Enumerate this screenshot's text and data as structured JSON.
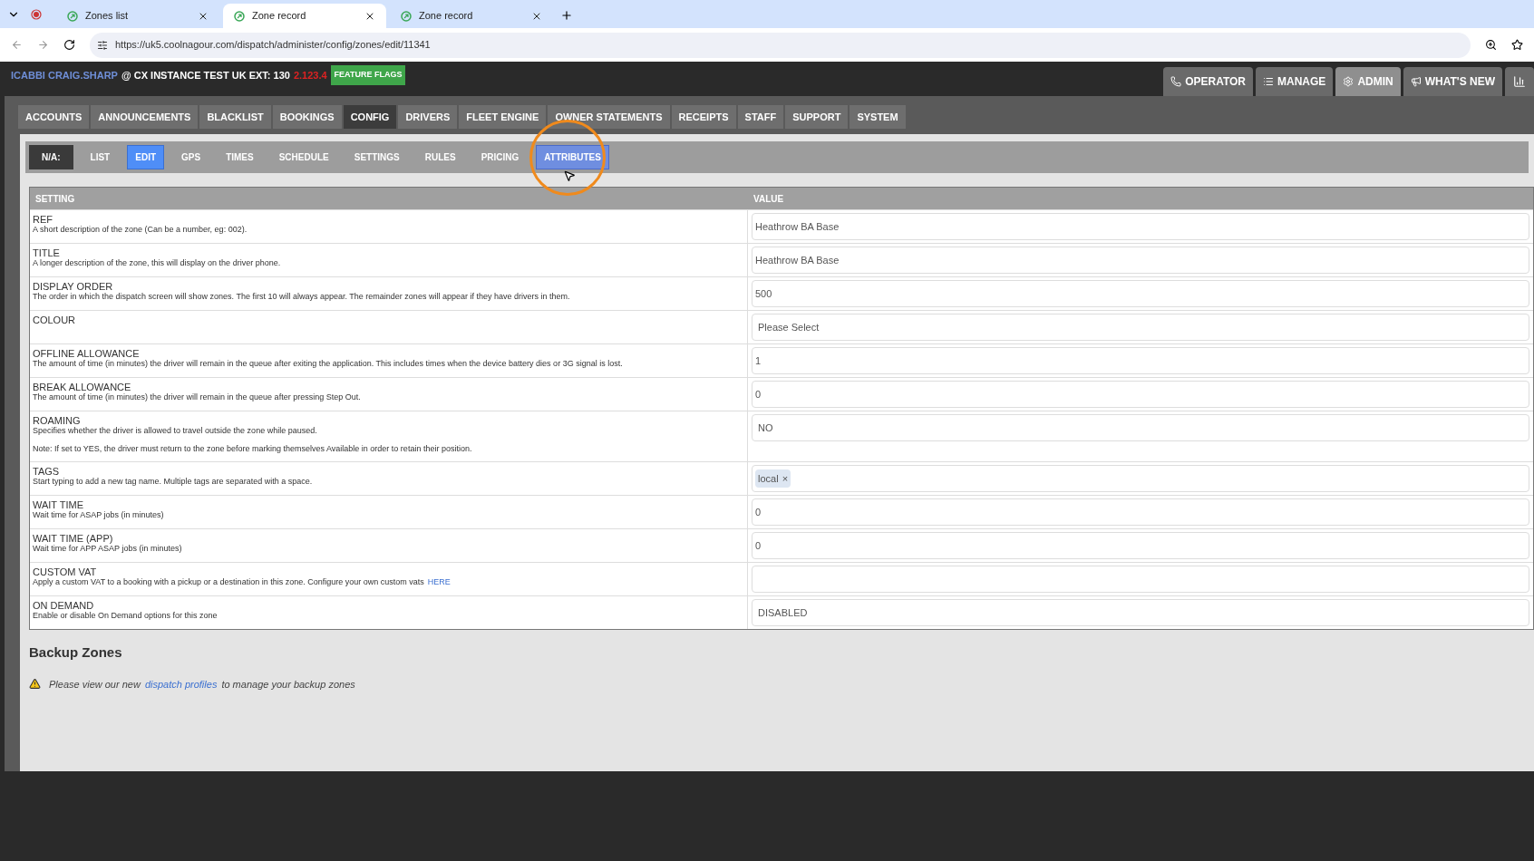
{
  "browser": {
    "tabs": [
      {
        "title": "Zones list",
        "selected": false
      },
      {
        "title": "Zone record",
        "selected": true
      },
      {
        "title": "Zone record",
        "selected": false
      }
    ],
    "url": "https://uk5.coolnagour.com/dispatch/administer/config/zones/edit/11341"
  },
  "header": {
    "user": "ICABBI CRAIG.SHARP",
    "instance": "@ CX INSTANCE TEST UK EXT: 130",
    "version": "2.123.4",
    "feature_flags": "FEATURE FLAGS",
    "buttons": [
      {
        "label": "OPERATOR",
        "kind": "phone",
        "selected": false
      },
      {
        "label": "MANAGE",
        "kind": "list",
        "selected": false
      },
      {
        "label": "ADMIN",
        "kind": "gear",
        "selected": true
      },
      {
        "label": "WHAT'S NEW",
        "kind": "megaphone",
        "selected": false
      }
    ]
  },
  "main_nav": [
    {
      "label": "ACCOUNTS",
      "selected": false
    },
    {
      "label": "ANNOUNCEMENTS",
      "selected": false
    },
    {
      "label": "BLACKLIST",
      "selected": false
    },
    {
      "label": "BOOKINGS",
      "selected": false
    },
    {
      "label": "CONFIG",
      "selected": true
    },
    {
      "label": "DRIVERS",
      "selected": false
    },
    {
      "label": "FLEET ENGINE",
      "selected": false
    },
    {
      "label": "OWNER STATEMENTS",
      "selected": false
    },
    {
      "label": "RECEIPTS",
      "selected": false
    },
    {
      "label": "STAFF",
      "selected": false
    },
    {
      "label": "SUPPORT",
      "selected": false
    },
    {
      "label": "SYSTEM",
      "selected": false
    }
  ],
  "sub_nav": {
    "prefix": "N/A:",
    "items": [
      {
        "label": "LIST",
        "selected": false,
        "hovered": false
      },
      {
        "label": "EDIT",
        "selected": true,
        "hovered": false
      },
      {
        "label": "GPS",
        "selected": false,
        "hovered": false
      },
      {
        "label": "TIMES",
        "selected": false,
        "hovered": false
      },
      {
        "label": "SCHEDULE",
        "selected": false,
        "hovered": false
      },
      {
        "label": "SETTINGS",
        "selected": false,
        "hovered": false
      },
      {
        "label": "RULES",
        "selected": false,
        "hovered": false
      },
      {
        "label": "PRICING",
        "selected": false,
        "hovered": false
      },
      {
        "label": "ATTRIBUTES",
        "selected": false,
        "hovered": true
      }
    ]
  },
  "table": {
    "columns": [
      "SETTING",
      "VALUE"
    ],
    "rows": [
      {
        "label": "REF",
        "description": "A short description of the zone (Can be a number, eg: 002).",
        "value": {
          "kind": "input",
          "text": "Heathrow BA Base"
        }
      },
      {
        "label": "TITLE",
        "description": "A longer description of the zone, this will display on the driver phone.",
        "value": {
          "kind": "input",
          "text": "Heathrow BA Base"
        }
      },
      {
        "label": "DISPLAY ORDER",
        "description": "The order in which the dispatch screen will show zones. The first 10 will always appear. The remainder zones will appear if they have drivers in them.",
        "value": {
          "kind": "input",
          "text": "500"
        }
      },
      {
        "label": "COLOUR",
        "value": {
          "kind": "select",
          "text": "Please Select"
        }
      },
      {
        "label": "OFFLINE ALLOWANCE",
        "description": "The amount of time (in minutes) the driver will remain in the queue after exiting the application. This includes times when the device battery dies or 3G signal is lost.",
        "value": {
          "kind": "input",
          "text": "1"
        }
      },
      {
        "label": "BREAK ALLOWANCE",
        "description": "The amount of time (in minutes) the driver will remain in the queue after pressing Step Out.",
        "value": {
          "kind": "input",
          "text": "0"
        }
      },
      {
        "label": "ROAMING",
        "description": "Specifies whether the driver is allowed to travel outside the zone while paused.",
        "note": "Note: If set to YES, the driver must return to the zone before marking themselves Available in order to retain their position.",
        "value": {
          "kind": "select",
          "text": "NO"
        }
      },
      {
        "label": "TAGS",
        "description": "Start typing to add a new tag name. Multiple tags are separated with a space.",
        "value": {
          "kind": "tags",
          "tags": [
            {
              "text": "local",
              "remove": "×"
            }
          ]
        }
      },
      {
        "label": "WAIT TIME",
        "description": "Wait time for ASAP jobs (in minutes)",
        "value": {
          "kind": "input",
          "text": "0"
        }
      },
      {
        "label": "WAIT TIME (APP)",
        "description": "Wait time for APP ASAP jobs (in minutes)",
        "value": {
          "kind": "input",
          "text": "0"
        }
      },
      {
        "label": "CUSTOM VAT",
        "description": "Apply a custom VAT to a booking with a pickup or a destination in this zone. Configure your own custom vats",
        "link": "HERE",
        "value": {
          "kind": "empty"
        }
      },
      {
        "label": "ON DEMAND",
        "description": "Enable or disable On Demand options for this zone",
        "value": {
          "kind": "select",
          "text": "DISABLED"
        }
      }
    ]
  },
  "backup": {
    "title": "Backup Zones",
    "before": "Please view our new",
    "link": "dispatch profiles",
    "after": "to manage your backup zones"
  }
}
